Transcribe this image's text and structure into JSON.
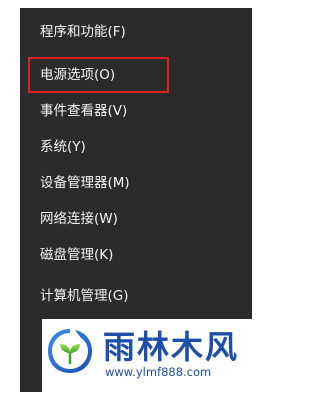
{
  "menu": {
    "items": [
      {
        "label": "程序和功能(F)"
      },
      {
        "label": "电源选项(O)"
      },
      {
        "label": "事件查看器(V)"
      },
      {
        "label": "系统(Y)"
      },
      {
        "label": "设备管理器(M)"
      },
      {
        "label": "网络连接(W)"
      },
      {
        "label": "磁盘管理(K)"
      },
      {
        "label": "计算机管理(G)"
      }
    ],
    "highlighted_item": "电源选项(O)",
    "background_color": "#2b2b2b",
    "text_color": "#f2f2f2",
    "highlight_color": "#e02020"
  },
  "watermark": {
    "title": "雨林木风",
    "url": "www.ylmf888.com",
    "brand_color": "#1e4fa8",
    "logo_icon": "seedling-logo-icon"
  }
}
